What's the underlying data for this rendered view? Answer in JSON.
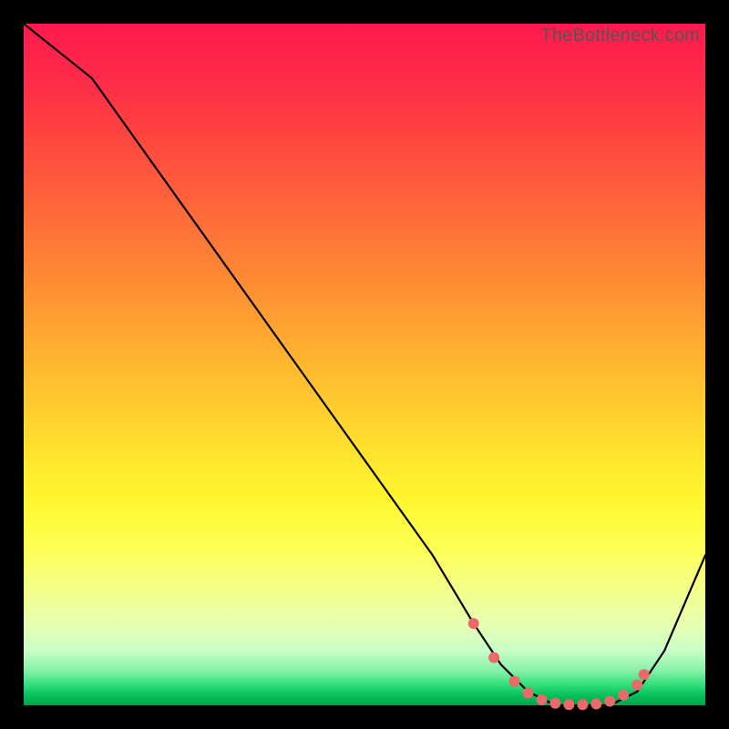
{
  "watermark": "TheBottleneck.com",
  "colors": {
    "marker": "#e96a6a",
    "curve": "#000000"
  },
  "chart_data": {
    "type": "line",
    "title": "",
    "xlabel": "",
    "ylabel": "",
    "xlim": [
      0,
      100
    ],
    "ylim": [
      0,
      100
    ],
    "grid": false,
    "legend": false,
    "series": [
      {
        "name": "curve",
        "x": [
          0,
          10,
          20,
          30,
          40,
          50,
          60,
          66,
          70,
          74,
          78,
          82,
          86,
          90,
          94,
          100
        ],
        "y": [
          100,
          92,
          78,
          64,
          50,
          36,
          22,
          12,
          6,
          2,
          0,
          0,
          0,
          2,
          8,
          22
        ]
      }
    ],
    "markers": {
      "name": "highlight-points",
      "x": [
        66,
        69,
        72,
        74,
        76,
        78,
        80,
        82,
        84,
        86,
        88,
        90,
        91
      ],
      "y": [
        12,
        7,
        3.5,
        1.8,
        0.8,
        0.3,
        0.1,
        0.1,
        0.2,
        0.6,
        1.5,
        3,
        4.5
      ]
    }
  }
}
